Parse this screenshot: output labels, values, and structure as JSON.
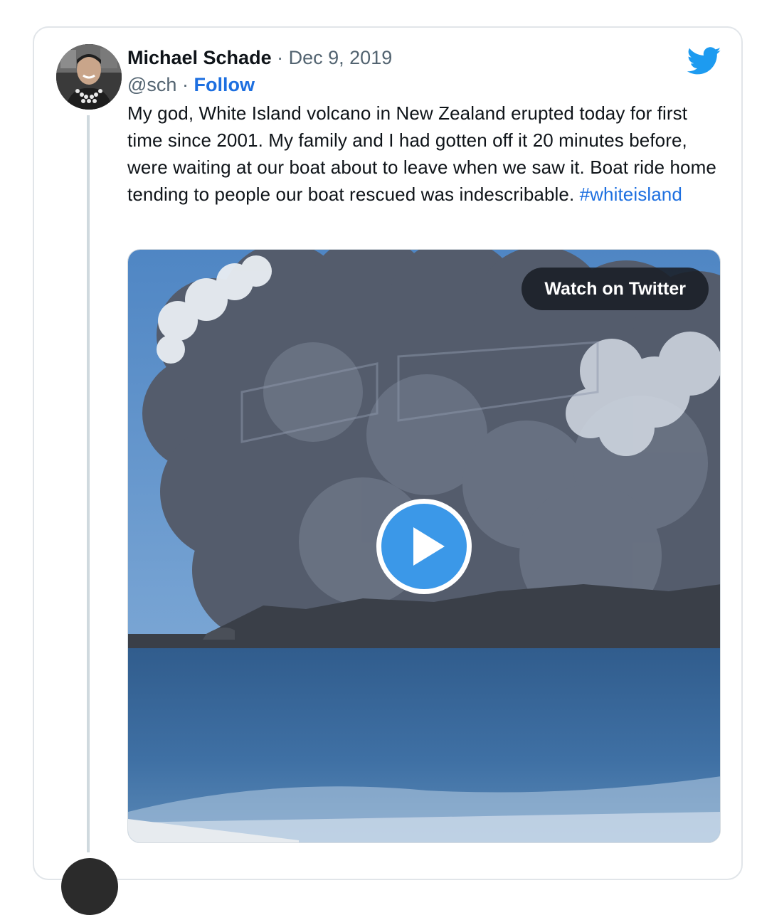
{
  "tweet": {
    "author_name": "Michael Schade",
    "separator": "·",
    "date": "Dec 9, 2019",
    "handle": "@sch",
    "follow_label": "Follow",
    "text": "My god, White Island volcano in New Zealand erupted today for first time since 2001. My family and I had gotten off it 20 minutes before, were waiting at our boat about to leave when we saw it. Boat ride home tending to people our boat rescued was indescribable.",
    "hashtag": "#whiteisland"
  },
  "media": {
    "watch_label": "Watch on Twitter",
    "play_icon": "play-icon",
    "scene": "volcano-eruption-video-thumbnail"
  },
  "icons": {
    "logo": "twitter-bird-icon",
    "logo_color": "#1d9bf0"
  },
  "colors": {
    "link": "#1d6fe0",
    "muted": "#536471",
    "play_button": "#3b98e8"
  }
}
